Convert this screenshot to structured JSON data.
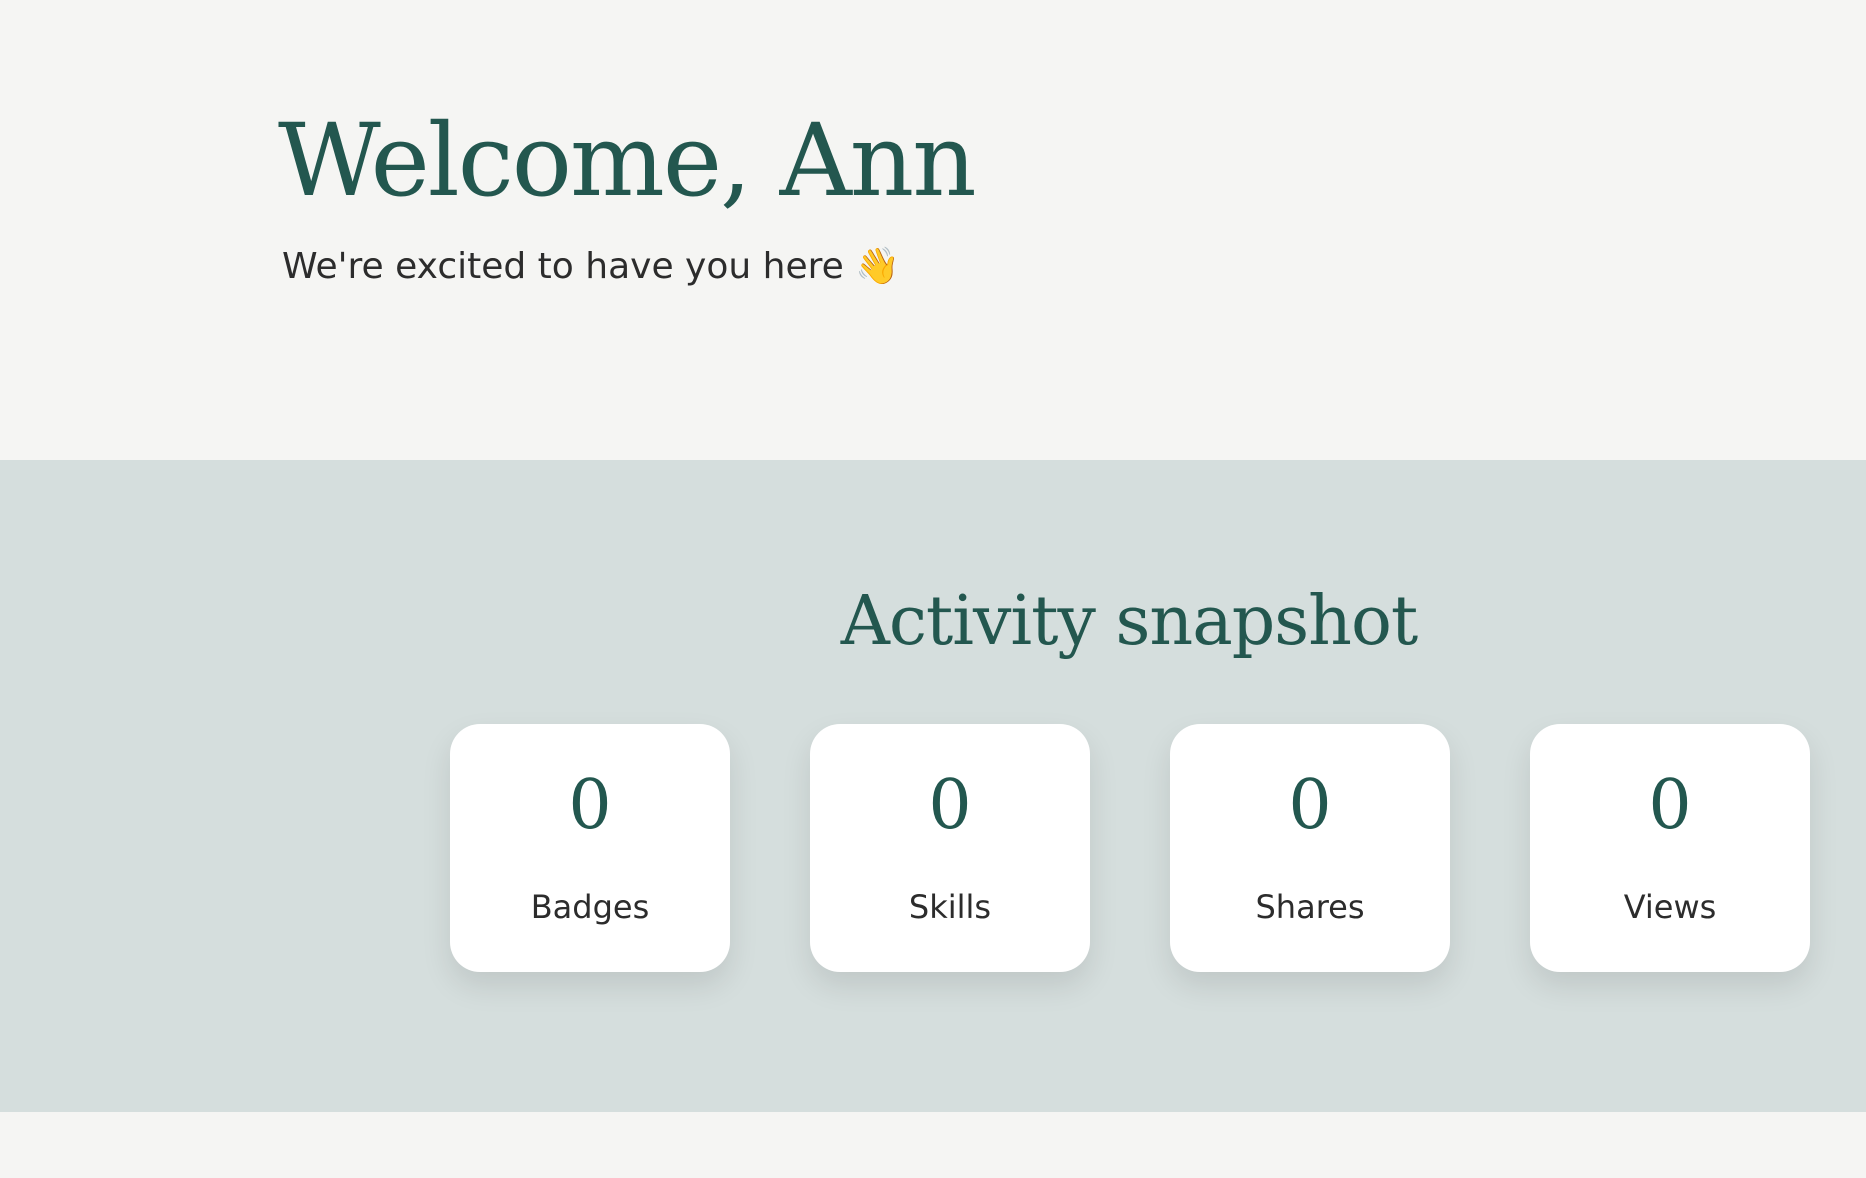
{
  "hero": {
    "title": "Welcome, Ann",
    "subtitle": "We're excited to have you here 👋"
  },
  "snapshot": {
    "title": "Activity snapshot",
    "stats": [
      {
        "value": "0",
        "label": "Badges"
      },
      {
        "value": "0",
        "label": "Skills"
      },
      {
        "value": "0",
        "label": "Shares"
      },
      {
        "value": "0",
        "label": "Views"
      }
    ]
  },
  "colors": {
    "accent": "#23574f",
    "hero_background": "#f5f5f3",
    "snapshot_background": "#d5dedd",
    "card_background": "#ffffff",
    "text": "#2c2c2c"
  }
}
